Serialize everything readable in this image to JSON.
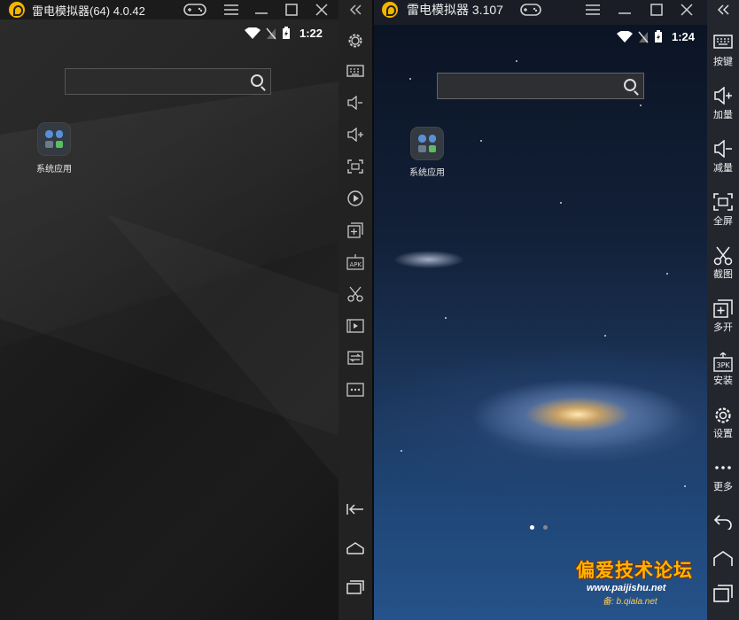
{
  "left": {
    "title": "雷电模拟器(64) 4.0.42",
    "clock": "1:22",
    "app_label": "系统应用"
  },
  "right": {
    "title": "雷电模拟器 3.107",
    "clock": "1:24",
    "app_label": "系统应用",
    "toolbar": [
      {
        "label": "按键",
        "icon": "keyboard-icon"
      },
      {
        "label": "加量",
        "icon": "volume-up-icon"
      },
      {
        "label": "减量",
        "icon": "volume-down-icon"
      },
      {
        "label": "全屏",
        "icon": "fullscreen-icon"
      },
      {
        "label": "截图",
        "icon": "scissors-icon"
      },
      {
        "label": "多开",
        "icon": "multi-open-icon"
      },
      {
        "label": "安装",
        "icon": "apk-install-icon"
      },
      {
        "label": "设置",
        "icon": "gear-icon"
      },
      {
        "label": "更多",
        "icon": "more-icon"
      }
    ]
  },
  "watermark": {
    "title": "偏爱技术论坛",
    "url": "www.paijishu.net",
    "url2": "备: b.qiala.net"
  },
  "colors": {
    "logo": "#f5b400",
    "watermark": "#ffb400"
  }
}
